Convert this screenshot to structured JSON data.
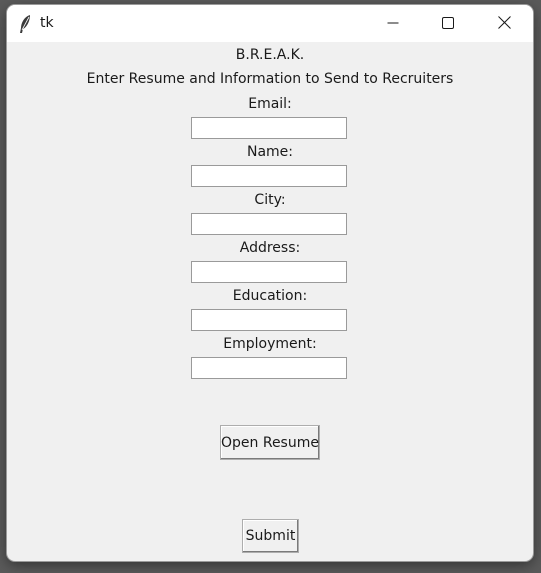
{
  "window": {
    "title": "tk",
    "icon": "feather-icon"
  },
  "titlebar_buttons": {
    "minimize_icon": "minimize-icon",
    "maximize_icon": "maximize-icon",
    "close_icon": "close-icon"
  },
  "app": {
    "heading": "B.R.E.A.K.",
    "subtitle": "Enter Resume and Information to Send to Recruiters"
  },
  "form": {
    "email": {
      "label": "Email:",
      "value": ""
    },
    "name": {
      "label": "Name:",
      "value": ""
    },
    "city": {
      "label": "City:",
      "value": ""
    },
    "address": {
      "label": "Address:",
      "value": ""
    },
    "education": {
      "label": "Education:",
      "value": ""
    },
    "employment": {
      "label": "Employment:",
      "value": ""
    }
  },
  "buttons": {
    "open_resume": "Open Resume",
    "submit": "Submit"
  }
}
